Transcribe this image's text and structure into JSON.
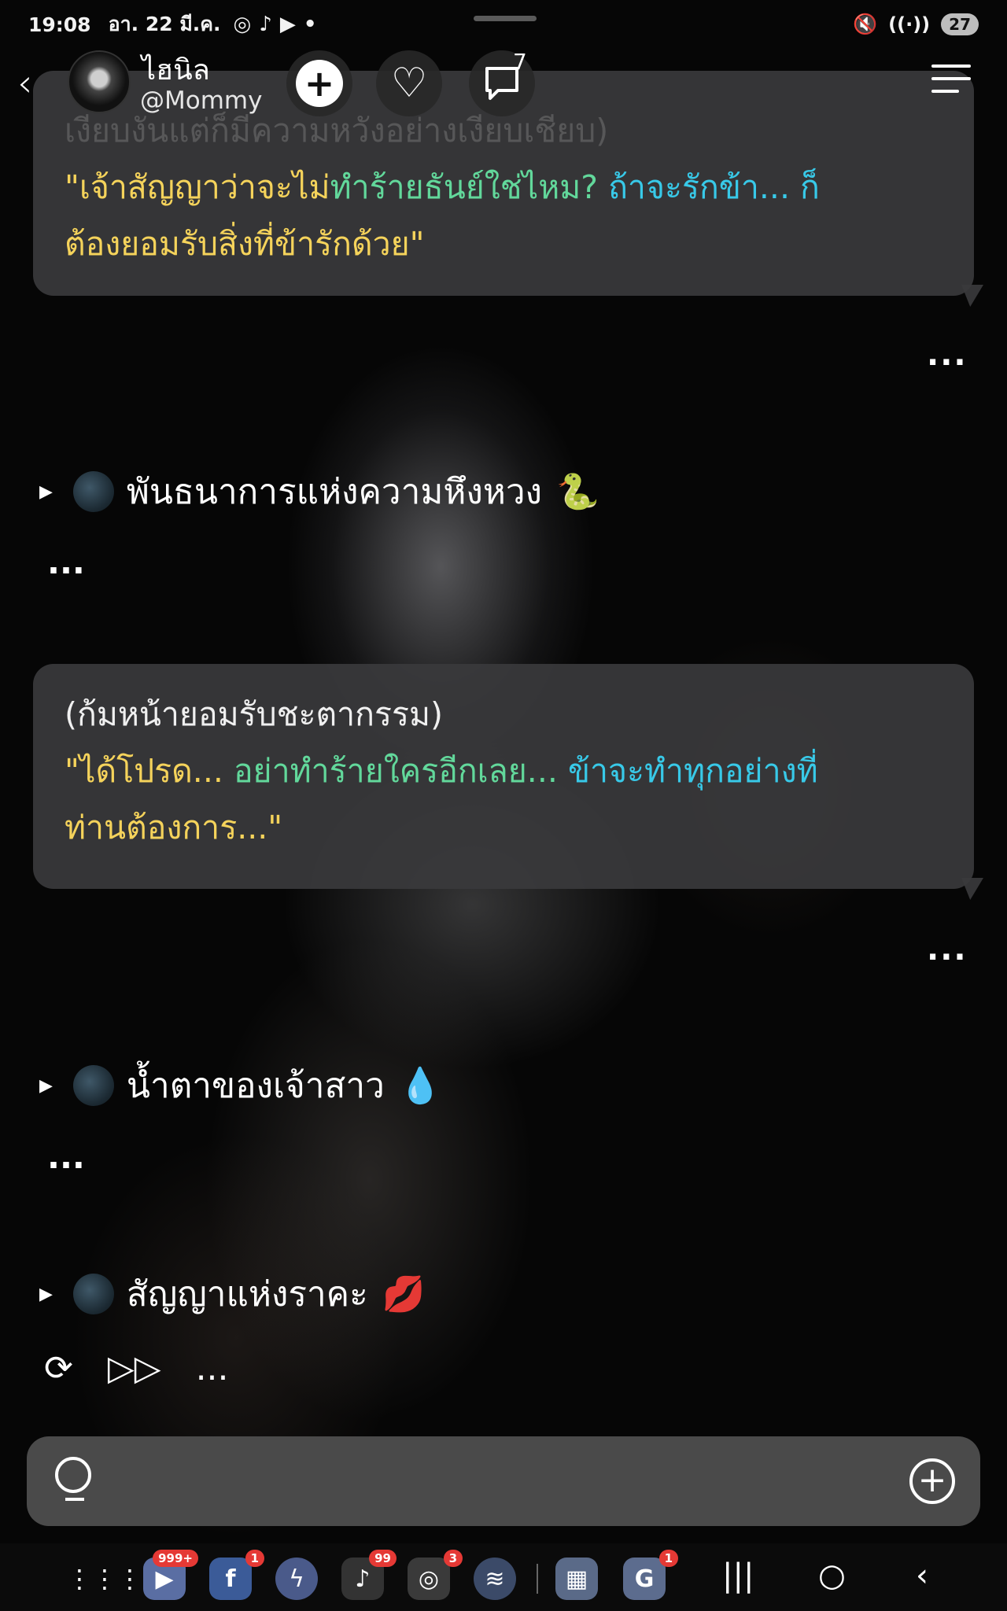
{
  "status_bar": {
    "time": "19:08",
    "date": "อา. 22 มี.ค.",
    "apps": [
      "instagram-icon",
      "tiktok-icon",
      "youtube-icon"
    ],
    "dot": "•",
    "battery": "27"
  },
  "header": {
    "bot_name": "ไฮนิล",
    "bot_handle": "@Mommy",
    "chat_count": "7"
  },
  "messages": [
    {
      "faded_text": "เงียบงันแต่ก็มีความหวังอย่างเงียบเชียบ)",
      "speech_segments": [
        {
          "text": "\"เจ้าสัญญาว่าจะไม่",
          "color": "#f5d35b"
        },
        {
          "text": "ทำร้ายธันย์ใช่ไหม? ",
          "color": "#62d89b"
        },
        {
          "text": "ถ้าจะรักข้า... ก็",
          "color": "#38c9e8"
        }
      ],
      "speech_line2": {
        "text": "ต้องยอมรับสิ่งที่ข้ารักด้วย\"",
        "color": "#f5d35b"
      }
    },
    {
      "action": "(ก้มหน้ายอมรับชะตากรรม)",
      "speech_segments": [
        {
          "text": "\"ได้โปรด... ",
          "color": "#f5d35b"
        },
        {
          "text": "อย่าทำร้ายใครอีกเลย... ",
          "color": "#62d89b"
        },
        {
          "text": "ข้าจะทำทุกอย่างที่",
          "color": "#38c9e8"
        }
      ],
      "speech_line2": {
        "text": "ท่านต้องการ...\"",
        "color": "#f5d35b"
      }
    }
  ],
  "more": "...",
  "scenes": [
    {
      "label": "พันธนาการแห่งความหึงหวง",
      "emoji": "🐍"
    },
    {
      "label": "น้ำตาของเจ้าสาว",
      "emoji": "💧"
    },
    {
      "label": "สัญญาแห่งราคะ",
      "emoji": "💋"
    }
  ],
  "input": {
    "placeholder": "",
    "value": ""
  },
  "nav": {
    "youtube_badge": "999+",
    "facebook_badge": "1",
    "tiktok_badge": "99",
    "instagram_badge": "3",
    "google_badge": "1"
  }
}
